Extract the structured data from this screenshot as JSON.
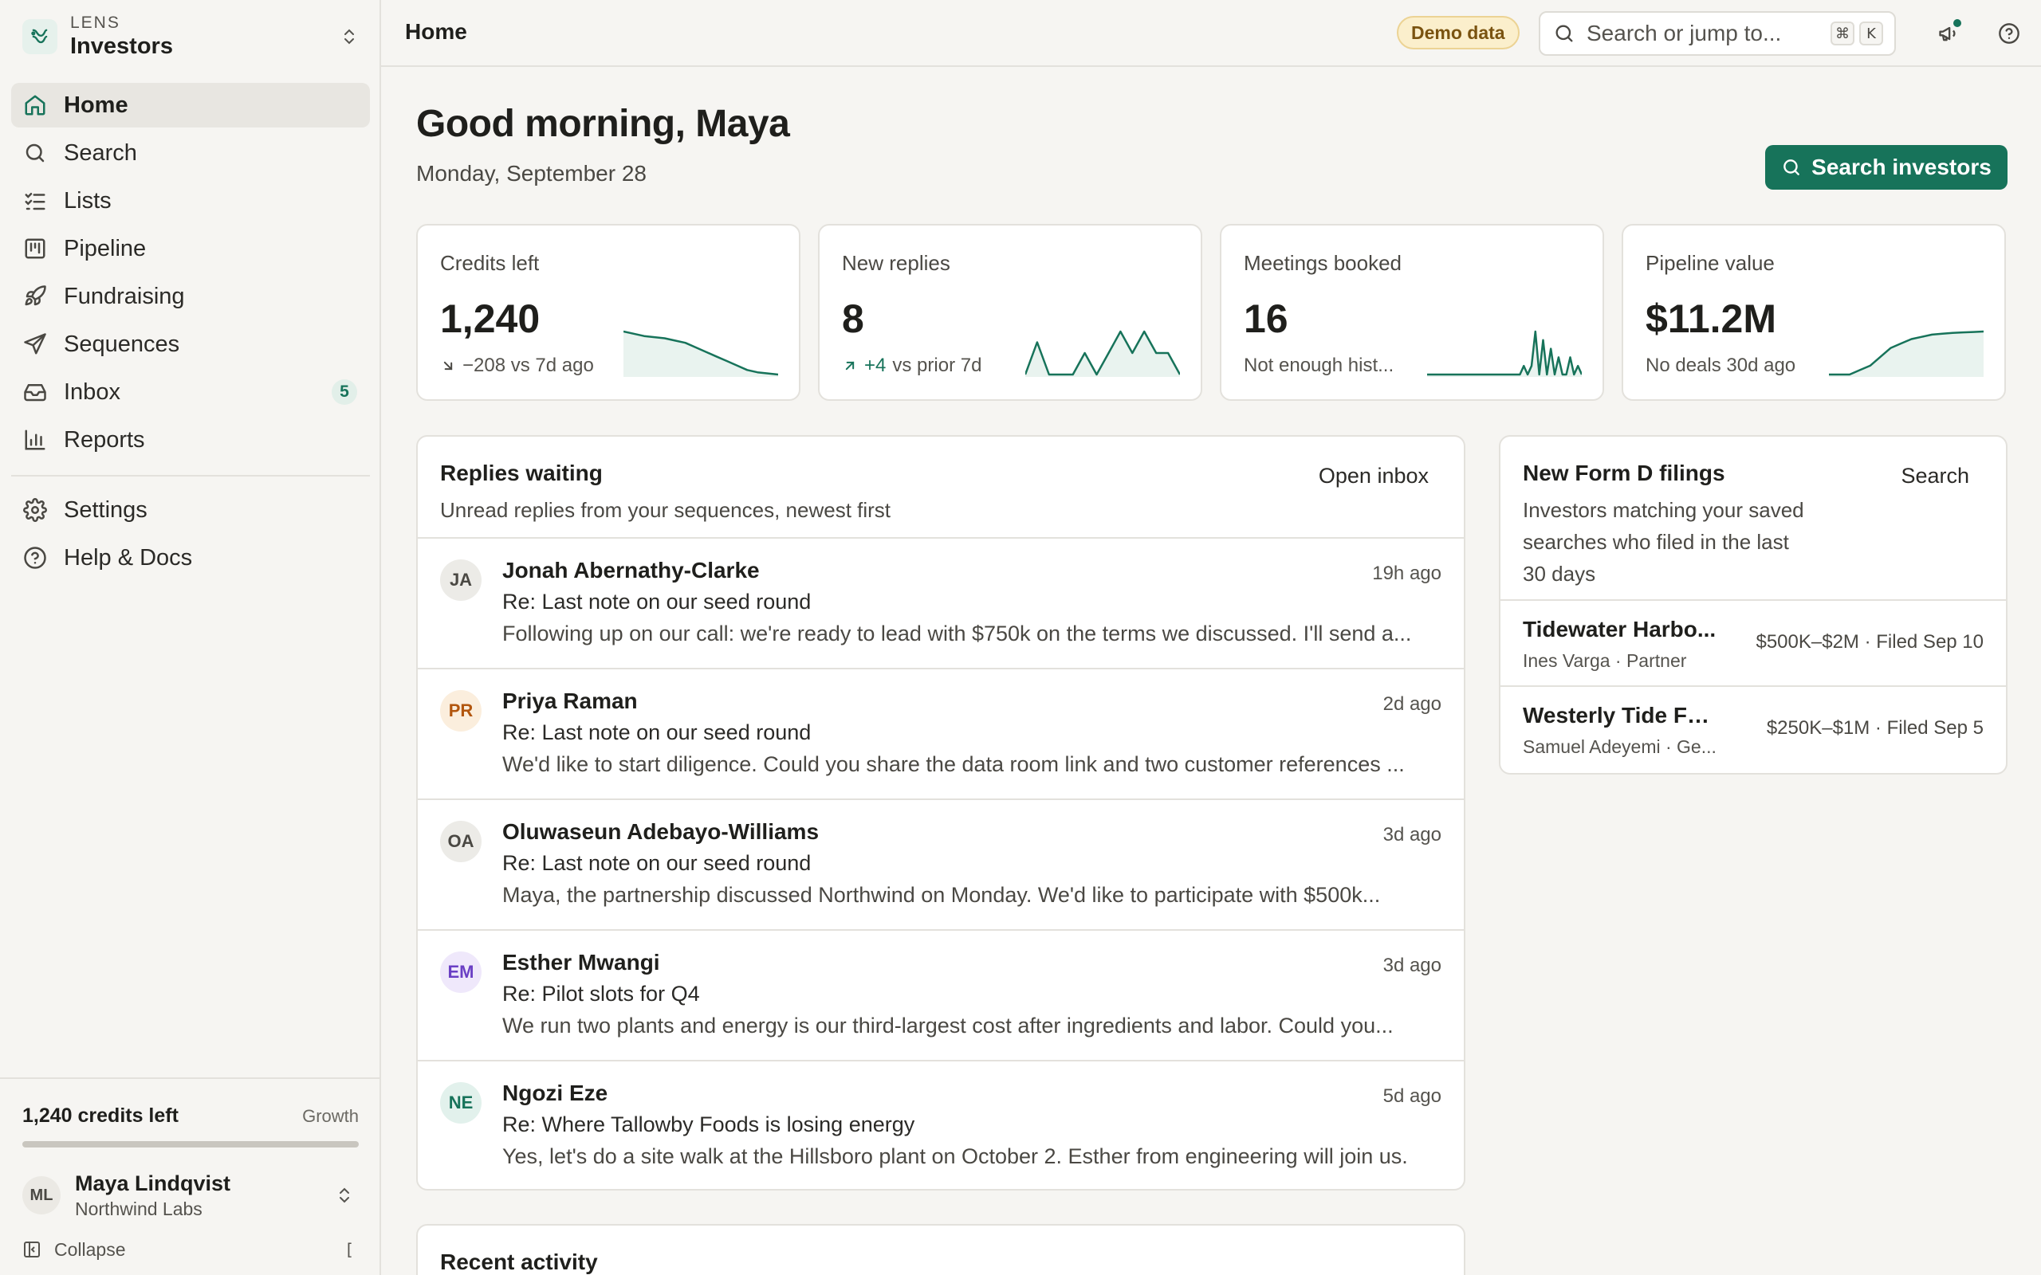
{
  "brand": {
    "kicker": "LENS",
    "name": "Investors"
  },
  "nav": {
    "items": [
      {
        "label": "Home",
        "icon": "home-icon"
      },
      {
        "label": "Search",
        "icon": "search-icon"
      },
      {
        "label": "Lists",
        "icon": "list-checks-icon"
      },
      {
        "label": "Pipeline",
        "icon": "kanban-icon"
      },
      {
        "label": "Fundraising",
        "icon": "rocket-icon"
      },
      {
        "label": "Sequences",
        "icon": "send-icon"
      },
      {
        "label": "Inbox",
        "icon": "inbox-icon",
        "badge": "5"
      },
      {
        "label": "Reports",
        "icon": "bar-chart-icon"
      }
    ],
    "secondary": [
      {
        "label": "Settings",
        "icon": "gear-icon"
      },
      {
        "label": "Help & Docs",
        "icon": "help-circle-icon"
      }
    ]
  },
  "sidebar_footer": {
    "credits": "1,240 credits left",
    "plan": "Growth",
    "credits_used_fraction": 1.0,
    "user": {
      "initials": "ML",
      "name": "Maya Lindqvist",
      "org": "Northwind Labs"
    },
    "collapse_label": "Collapse",
    "collapse_shortcut": "["
  },
  "topbar": {
    "title": "Home",
    "demo_badge": "Demo data",
    "search_placeholder": "Search or jump to...",
    "shortcut_keys": [
      "⌘",
      "K"
    ]
  },
  "header": {
    "greeting": "Good morning, Maya",
    "date": "Monday, September 28",
    "primary_button": "Search investors"
  },
  "stats": [
    {
      "label": "Credits left",
      "value": "1,240",
      "trend_icon": "arrow-down-right-icon",
      "sub": "−208 vs 7d ago",
      "sparkline": [
        30,
        29,
        28,
        27.5,
        27,
        26,
        25,
        23,
        21,
        19,
        17,
        15,
        13,
        12,
        11.5,
        11
      ]
    },
    {
      "label": "New replies",
      "value": "8",
      "trend_icon": "arrow-up-right-icon",
      "sub_em": "+4",
      "sub": "vs prior 7d",
      "sparkline": [
        0,
        3,
        0,
        0,
        0,
        2,
        0,
        2,
        4,
        2,
        4,
        2,
        2,
        0
      ]
    },
    {
      "label": "Meetings booked",
      "value": "16",
      "sub": "Not enough hist...",
      "sparkline": [
        0,
        0,
        0,
        0,
        0,
        0,
        0,
        0,
        0,
        0,
        0,
        0,
        0,
        0,
        0,
        0,
        0,
        0,
        0,
        0,
        0,
        0,
        0,
        0,
        0,
        1,
        0,
        1,
        5,
        0,
        4,
        0,
        3,
        0,
        2,
        0,
        0,
        2,
        0,
        1,
        0
      ]
    },
    {
      "label": "Pipeline value",
      "value": "$11.2M",
      "sub": "No deals 30d ago",
      "sparkline": [
        0,
        0,
        0,
        1,
        2,
        4,
        6,
        7,
        8,
        8.5,
        9,
        9.2,
        9.4,
        9.5,
        9.6,
        9.7
      ]
    }
  ],
  "replies_panel": {
    "title": "Replies waiting",
    "subtitle": "Unread replies from your sequences, newest first",
    "action": "Open inbox",
    "items": [
      {
        "initials": "JA",
        "name": "Jonah Abernathy-Clarke",
        "time": "19h ago",
        "subject": "Re: Last note on our seed round",
        "preview": "Following up on our call: we're ready to lead with $750k on the terms we discussed. I'll send a...",
        "avatar_bg": "#ecebe7",
        "avatar_fg": "#4a4843"
      },
      {
        "initials": "PR",
        "name": "Priya Raman",
        "time": "2d ago",
        "subject": "Re: Last note on our seed round",
        "preview": "We'd like to start diligence. Could you share the data room link and two customer references ...",
        "avatar_bg": "#fbeedd",
        "avatar_fg": "#b2560e"
      },
      {
        "initials": "OA",
        "name": "Oluwaseun Adebayo-Williams",
        "time": "3d ago",
        "subject": "Re: Last note on our seed round",
        "preview": "Maya, the partnership discussed Northwind on Monday. We'd like to participate with $500k...",
        "avatar_bg": "#ecebe7",
        "avatar_fg": "#4a4843"
      },
      {
        "initials": "EM",
        "name": "Esther Mwangi",
        "time": "3d ago",
        "subject": "Re: Pilot slots for Q4",
        "preview": "We run two plants and energy is our third-largest cost after ingredients and labor. Could you...",
        "avatar_bg": "#efe8fb",
        "avatar_fg": "#6a3fc4"
      },
      {
        "initials": "NE",
        "name": "Ngozi Eze",
        "time": "5d ago",
        "subject": "Re: Where Tallowby Foods is losing energy",
        "preview": "Yes, let's do a site walk at the Hillsboro plant on October 2. Esther from engineering will join us.",
        "avatar_bg": "#e2f1ec",
        "avatar_fg": "#17735a"
      }
    ]
  },
  "filings_panel": {
    "title": "New Form D filings",
    "subtitle_lines": [
      "Investors matching your saved",
      "searches who filed in the last",
      "30 days"
    ],
    "action": "Search",
    "items": [
      {
        "name": "Tidewater Harbo...",
        "sub": "Ines Varga · Partner",
        "meta": "$500K–$2M · Filed Sep 10"
      },
      {
        "name": "Westerly Tide Fund",
        "sub": "Samuel Adeyemi · Ge...",
        "meta": "$250K–$1M · Filed Sep 5"
      }
    ]
  },
  "activity_panel": {
    "title": "Recent activity"
  },
  "colors": {
    "accent": "#17735a",
    "spark_fill": "#e9f3ef",
    "demo_bg": "#fbefcc"
  }
}
